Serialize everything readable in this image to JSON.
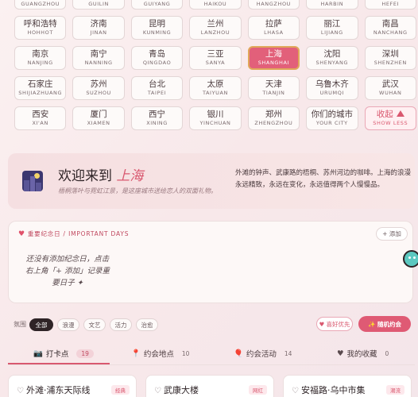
{
  "cities": {
    "row0": [
      {
        "zh": "",
        "en": "GUANGZHOU"
      },
      {
        "zh": "",
        "en": "GUILIN"
      },
      {
        "zh": "",
        "en": "GUIYANG"
      },
      {
        "zh": "",
        "en": "HAIKOU"
      },
      {
        "zh": "",
        "en": "HANGZHOU"
      },
      {
        "zh": "",
        "en": "HARBIN"
      },
      {
        "zh": "",
        "en": "HEFEI"
      }
    ],
    "row1": [
      {
        "zh": "呼和浩特",
        "en": "HOHHOT"
      },
      {
        "zh": "济南",
        "en": "JINAN"
      },
      {
        "zh": "昆明",
        "en": "KUNMING"
      },
      {
        "zh": "兰州",
        "en": "LANZHOU"
      },
      {
        "zh": "拉萨",
        "en": "LHASA"
      },
      {
        "zh": "丽江",
        "en": "LIJIANG"
      },
      {
        "zh": "南昌",
        "en": "NANCHANG"
      }
    ],
    "row2": [
      {
        "zh": "南京",
        "en": "NANJING"
      },
      {
        "zh": "南宁",
        "en": "NANNING"
      },
      {
        "zh": "青岛",
        "en": "QINGDAO"
      },
      {
        "zh": "三亚",
        "en": "SANYA"
      },
      {
        "zh": "上海",
        "en": "SHANGHAI",
        "active": true
      },
      {
        "zh": "沈阳",
        "en": "SHENYANG"
      },
      {
        "zh": "深圳",
        "en": "SHENZHEN"
      }
    ],
    "row3": [
      {
        "zh": "石家庄",
        "en": "SHIJIAZHUANG"
      },
      {
        "zh": "苏州",
        "en": "SUZHOU"
      },
      {
        "zh": "台北",
        "en": "TAIPEI"
      },
      {
        "zh": "太原",
        "en": "TAIYUAN"
      },
      {
        "zh": "天津",
        "en": "TIANJIN"
      },
      {
        "zh": "乌鲁木齐",
        "en": "URUMQI"
      },
      {
        "zh": "武汉",
        "en": "WUHAN"
      }
    ],
    "row4": [
      {
        "zh": "西安",
        "en": "XI'AN"
      },
      {
        "zh": "厦门",
        "en": "XIAMEN"
      },
      {
        "zh": "西宁",
        "en": "XINING"
      },
      {
        "zh": "银川",
        "en": "YINCHUAN"
      },
      {
        "zh": "郑州",
        "en": "ZHENGZHOU"
      },
      {
        "zh": "你们的城市",
        "en": "YOUR CITY"
      }
    ],
    "show_less": {
      "zh": "收起",
      "en": "SHOW LESS"
    }
  },
  "welcome": {
    "prefix": "欢迎来到 ",
    "city": "上海",
    "subtitle": "梧桐落叶与霓虹江景，是这座城市送给恋人的双面礼物。",
    "description": "外滩的钟声、武康路的梧桐、苏州河边的咖啡。上海的浪漫永远精致，永远在变化，永远值得两个人慢慢品。"
  },
  "important_days": {
    "heading": "重要纪念日 / IMPORTANT DAYS",
    "add_label": "+ 添加",
    "empty_text": "还没有添加纪念日，点击右上角「+ 添加」记录重要日子 ✦"
  },
  "filters": {
    "label": "氛围",
    "chips": [
      "全部",
      "浪漫",
      "文艺",
      "活力",
      "治愈"
    ],
    "pref_label": "♥ 喜好优先",
    "random_label": "✨ 随机约会"
  },
  "tabs": [
    {
      "label": "打卡点",
      "count": "19"
    },
    {
      "label": "约会地点",
      "count": "10"
    },
    {
      "label": "约会活动",
      "count": "14"
    },
    {
      "label": "我的收藏",
      "count": "0"
    }
  ],
  "spots": [
    {
      "name": "外滩·浦东天际线",
      "tag": "经典"
    },
    {
      "name": "武康大楼",
      "tag": "网红"
    },
    {
      "name": "安福路·乌中市集",
      "tag": "潮流"
    }
  ],
  "colors": {
    "accent": "#df5a74",
    "active_border": "#e0a85a"
  }
}
